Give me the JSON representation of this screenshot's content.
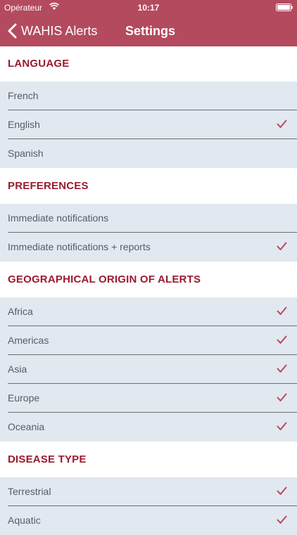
{
  "status_bar": {
    "carrier": "Opérateur",
    "time": "10:17"
  },
  "nav": {
    "back_label": "WAHIS Alerts",
    "title": "Settings"
  },
  "accent_color": "#b44a5e",
  "section_color": "#9b1b2e",
  "sections": [
    {
      "title": "LANGUAGE",
      "items": [
        {
          "label": "French",
          "checked": false
        },
        {
          "label": "English",
          "checked": true
        },
        {
          "label": "Spanish",
          "checked": false
        }
      ]
    },
    {
      "title": "PREFERENCES",
      "items": [
        {
          "label": "Immediate notifications",
          "checked": false
        },
        {
          "label": "Immediate notifications + reports",
          "checked": true
        }
      ]
    },
    {
      "title": "GEOGRAPHICAL ORIGIN OF ALERTS",
      "items": [
        {
          "label": "Africa",
          "checked": true
        },
        {
          "label": "Americas",
          "checked": true
        },
        {
          "label": "Asia",
          "checked": true
        },
        {
          "label": "Europe",
          "checked": true
        },
        {
          "label": "Oceania",
          "checked": true
        }
      ]
    },
    {
      "title": "DISEASE TYPE",
      "items": [
        {
          "label": "Terrestrial",
          "checked": true
        },
        {
          "label": "Aquatic",
          "checked": true
        }
      ]
    }
  ]
}
